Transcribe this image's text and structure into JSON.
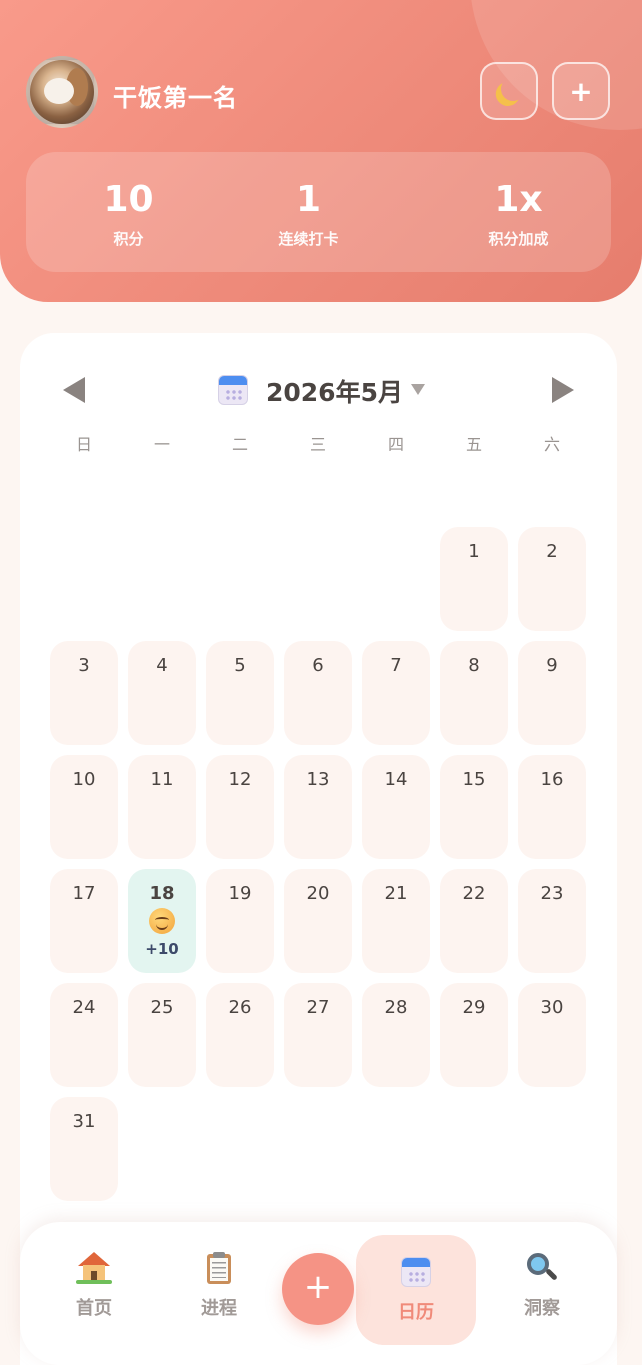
{
  "header": {
    "username": "干饭第一名",
    "moon_button_icon": "moon-icon",
    "add_button_label": "+",
    "stats": [
      {
        "value": "10",
        "label": "积分"
      },
      {
        "value": "1",
        "label": "连续打卡"
      },
      {
        "value": "1x",
        "label": "积分加成"
      }
    ]
  },
  "calendar": {
    "month_title": "2026年5月",
    "weekdays": [
      "日",
      "一",
      "二",
      "三",
      "四",
      "五",
      "六"
    ],
    "first_weekday_index": 5,
    "days_in_month": 31,
    "today": {
      "day": "18",
      "emoji": "smiling-face-icon",
      "points": "+10"
    }
  },
  "bottom_nav": {
    "items": [
      {
        "label": "首页",
        "icon": "house-icon"
      },
      {
        "label": "进程",
        "icon": "clipboard-icon"
      },
      {
        "label": "日历",
        "icon": "calendar-icon",
        "active": true
      },
      {
        "label": "洞察",
        "icon": "magnifier-icon"
      }
    ],
    "fab_label": "+"
  },
  "colors": {
    "header_gradient_start": "#f99a8a",
    "header_gradient_end": "#e67d6d",
    "today_bg": "#e3f5f0",
    "day_bg": "#fdf4f0",
    "active_nav_bg": "#fde3dc",
    "active_nav_text": "#f08a79",
    "fab": "#f59385"
  }
}
